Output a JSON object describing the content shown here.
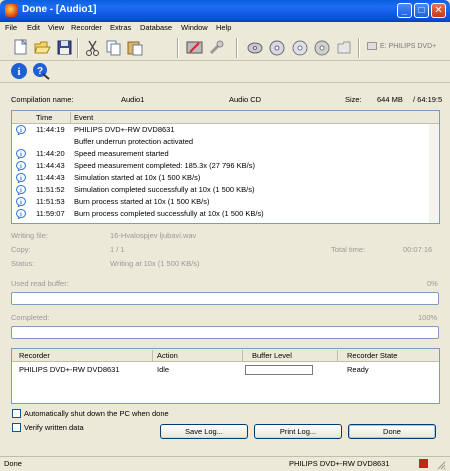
{
  "window": {
    "title": "Done - [Audio1]",
    "minimize_label": "_",
    "maximize_label": "□",
    "close_label": "✕"
  },
  "menu": [
    "File",
    "Edit",
    "View",
    "Recorder",
    "Extras",
    "Database",
    "Window",
    "Help"
  ],
  "toolbar": {
    "drive_selector": "E: PHILIPS DVD+"
  },
  "compilation": {
    "name_label": "Compilation name:",
    "name_value": "Audio1",
    "type_value": "Audio CD",
    "size_label": "Size:",
    "size_value": "644 MB",
    "duration_value": "/ 64:19:5"
  },
  "log": {
    "col_time": "Time",
    "col_event": "Event",
    "rows": [
      {
        "time": "11:44:19",
        "event": "PHILIPS DVD+-RW DVD8631",
        "icon": "info-icon"
      },
      {
        "time": "",
        "event": "Buffer underrun protection activated",
        "icon": ""
      },
      {
        "time": "11:44:20",
        "event": "Speed measurement started",
        "icon": "info-icon"
      },
      {
        "time": "11:44:43",
        "event": "Speed measurement completed: 185.3x (27 796 KB/s)",
        "icon": "info-icon"
      },
      {
        "time": "11:44:43",
        "event": "Simulation started at 10x (1 500 KB/s)",
        "icon": "info-icon"
      },
      {
        "time": "11:51:52",
        "event": "Simulation completed successfully at 10x (1 500 KB/s)",
        "icon": "info-icon"
      },
      {
        "time": "11:51:53",
        "event": "Burn process started at 10x (1 500 KB/s)",
        "icon": "info-icon"
      },
      {
        "time": "11:59:07",
        "event": "Burn process completed successfully at 10x (1 500 KB/s)",
        "icon": "info-icon"
      }
    ]
  },
  "status": {
    "writing_file_label": "Writing file:",
    "writing_file_value": "16-Hvalospjev ljubavi.wav",
    "copy_label": "Copy:",
    "copy_value": "1 / 1",
    "total_time_label": "Total time:",
    "total_time_value": "00:07:16",
    "status_label": "Status:",
    "status_value": "Writing at 10x (1 500 KB/s)",
    "used_read_buffer_label": "Used read buffer:",
    "used_read_buffer_value": "0%",
    "completed_label": "Completed:",
    "completed_value": "100%",
    "read_buffer_fraction": 0,
    "completed_fraction": 0
  },
  "recorders": {
    "col_recorder": "Recorder",
    "col_action": "Action",
    "col_buffer": "Buffer Level",
    "col_state": "Recorder State",
    "rows": [
      {
        "recorder": "PHILIPS DVD+-RW DVD8631",
        "action": "Idle",
        "state": "Ready"
      }
    ]
  },
  "options": {
    "auto_shutdown": "Automatically shut down the PC when done",
    "verify": "Verify written data"
  },
  "buttons": {
    "save_log": "Save Log...",
    "print_log": "Print Log...",
    "done": "Done"
  },
  "statusbar": {
    "left": "Done",
    "right": "PHILIPS DVD+-RW DVD8631"
  },
  "colors": {
    "titlebar": "#0a5fe0",
    "info_icon": "#2a6fd6",
    "field_border": "#7f9db9"
  }
}
